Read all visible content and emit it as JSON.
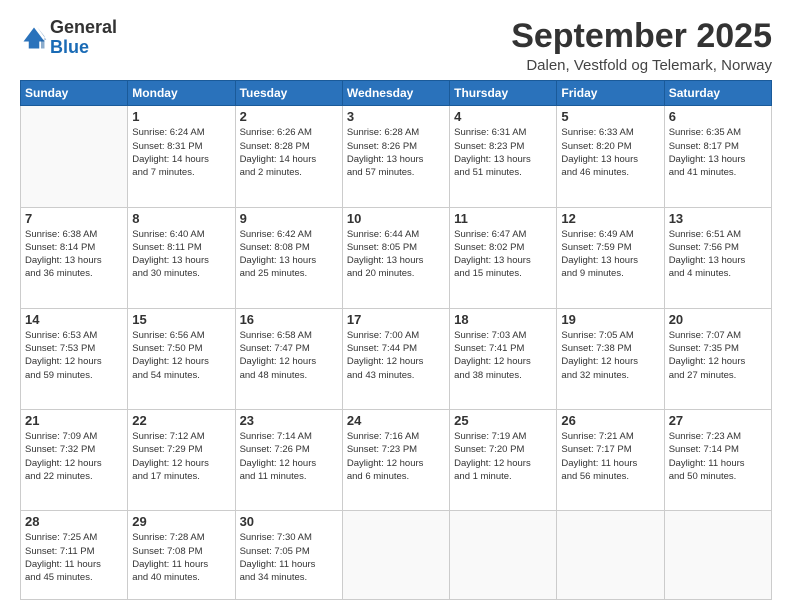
{
  "header": {
    "logo_general": "General",
    "logo_blue": "Blue",
    "month_title": "September 2025",
    "subtitle": "Dalen, Vestfold og Telemark, Norway"
  },
  "days_of_week": [
    "Sunday",
    "Monday",
    "Tuesday",
    "Wednesday",
    "Thursday",
    "Friday",
    "Saturday"
  ],
  "weeks": [
    [
      {
        "day": "",
        "info": ""
      },
      {
        "day": "1",
        "info": "Sunrise: 6:24 AM\nSunset: 8:31 PM\nDaylight: 14 hours\nand 7 minutes."
      },
      {
        "day": "2",
        "info": "Sunrise: 6:26 AM\nSunset: 8:28 PM\nDaylight: 14 hours\nand 2 minutes."
      },
      {
        "day": "3",
        "info": "Sunrise: 6:28 AM\nSunset: 8:26 PM\nDaylight: 13 hours\nand 57 minutes."
      },
      {
        "day": "4",
        "info": "Sunrise: 6:31 AM\nSunset: 8:23 PM\nDaylight: 13 hours\nand 51 minutes."
      },
      {
        "day": "5",
        "info": "Sunrise: 6:33 AM\nSunset: 8:20 PM\nDaylight: 13 hours\nand 46 minutes."
      },
      {
        "day": "6",
        "info": "Sunrise: 6:35 AM\nSunset: 8:17 PM\nDaylight: 13 hours\nand 41 minutes."
      }
    ],
    [
      {
        "day": "7",
        "info": "Sunrise: 6:38 AM\nSunset: 8:14 PM\nDaylight: 13 hours\nand 36 minutes."
      },
      {
        "day": "8",
        "info": "Sunrise: 6:40 AM\nSunset: 8:11 PM\nDaylight: 13 hours\nand 30 minutes."
      },
      {
        "day": "9",
        "info": "Sunrise: 6:42 AM\nSunset: 8:08 PM\nDaylight: 13 hours\nand 25 minutes."
      },
      {
        "day": "10",
        "info": "Sunrise: 6:44 AM\nSunset: 8:05 PM\nDaylight: 13 hours\nand 20 minutes."
      },
      {
        "day": "11",
        "info": "Sunrise: 6:47 AM\nSunset: 8:02 PM\nDaylight: 13 hours\nand 15 minutes."
      },
      {
        "day": "12",
        "info": "Sunrise: 6:49 AM\nSunset: 7:59 PM\nDaylight: 13 hours\nand 9 minutes."
      },
      {
        "day": "13",
        "info": "Sunrise: 6:51 AM\nSunset: 7:56 PM\nDaylight: 13 hours\nand 4 minutes."
      }
    ],
    [
      {
        "day": "14",
        "info": "Sunrise: 6:53 AM\nSunset: 7:53 PM\nDaylight: 12 hours\nand 59 minutes."
      },
      {
        "day": "15",
        "info": "Sunrise: 6:56 AM\nSunset: 7:50 PM\nDaylight: 12 hours\nand 54 minutes."
      },
      {
        "day": "16",
        "info": "Sunrise: 6:58 AM\nSunset: 7:47 PM\nDaylight: 12 hours\nand 48 minutes."
      },
      {
        "day": "17",
        "info": "Sunrise: 7:00 AM\nSunset: 7:44 PM\nDaylight: 12 hours\nand 43 minutes."
      },
      {
        "day": "18",
        "info": "Sunrise: 7:03 AM\nSunset: 7:41 PM\nDaylight: 12 hours\nand 38 minutes."
      },
      {
        "day": "19",
        "info": "Sunrise: 7:05 AM\nSunset: 7:38 PM\nDaylight: 12 hours\nand 32 minutes."
      },
      {
        "day": "20",
        "info": "Sunrise: 7:07 AM\nSunset: 7:35 PM\nDaylight: 12 hours\nand 27 minutes."
      }
    ],
    [
      {
        "day": "21",
        "info": "Sunrise: 7:09 AM\nSunset: 7:32 PM\nDaylight: 12 hours\nand 22 minutes."
      },
      {
        "day": "22",
        "info": "Sunrise: 7:12 AM\nSunset: 7:29 PM\nDaylight: 12 hours\nand 17 minutes."
      },
      {
        "day": "23",
        "info": "Sunrise: 7:14 AM\nSunset: 7:26 PM\nDaylight: 12 hours\nand 11 minutes."
      },
      {
        "day": "24",
        "info": "Sunrise: 7:16 AM\nSunset: 7:23 PM\nDaylight: 12 hours\nand 6 minutes."
      },
      {
        "day": "25",
        "info": "Sunrise: 7:19 AM\nSunset: 7:20 PM\nDaylight: 12 hours\nand 1 minute."
      },
      {
        "day": "26",
        "info": "Sunrise: 7:21 AM\nSunset: 7:17 PM\nDaylight: 11 hours\nand 56 minutes."
      },
      {
        "day": "27",
        "info": "Sunrise: 7:23 AM\nSunset: 7:14 PM\nDaylight: 11 hours\nand 50 minutes."
      }
    ],
    [
      {
        "day": "28",
        "info": "Sunrise: 7:25 AM\nSunset: 7:11 PM\nDaylight: 11 hours\nand 45 minutes."
      },
      {
        "day": "29",
        "info": "Sunrise: 7:28 AM\nSunset: 7:08 PM\nDaylight: 11 hours\nand 40 minutes."
      },
      {
        "day": "30",
        "info": "Sunrise: 7:30 AM\nSunset: 7:05 PM\nDaylight: 11 hours\nand 34 minutes."
      },
      {
        "day": "",
        "info": ""
      },
      {
        "day": "",
        "info": ""
      },
      {
        "day": "",
        "info": ""
      },
      {
        "day": "",
        "info": ""
      }
    ]
  ]
}
